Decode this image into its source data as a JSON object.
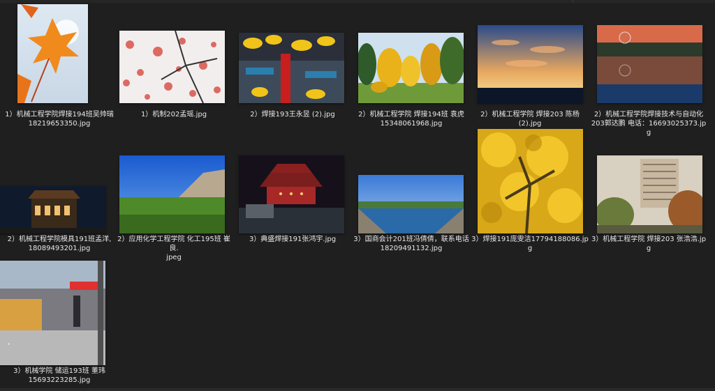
{
  "files": [
    {
      "line1": "1）机械工程学院焊接194班吴帅瑞",
      "line2": "18219653350.jpg",
      "art": "maple-leaf"
    },
    {
      "line1": "1）机制202孟瑶.jpg",
      "line2": "",
      "art": "red-leaves"
    },
    {
      "line1": "2）焊接193王永昱 (2).jpg",
      "line2": "",
      "art": "temple-gold"
    },
    {
      "line1": "2）机械工程学院 焊接194班 袁虎",
      "line2": "15348061968.jpg",
      "art": "autumn-trees"
    },
    {
      "line1": "2）机械工程学院 焊接203 陈杨",
      "line2": "(2).jpg",
      "art": "sunset-lake"
    },
    {
      "line1": "2）机械工程学院焊接技术与自动化",
      "line2": "203郭达鹏  电话：16693025373.jpg",
      "art": "sunset-reflect"
    },
    {
      "line1": "2）机械工程学院模具191班孟洋,",
      "line2": "18089493201.jpg",
      "art": "night-tower"
    },
    {
      "line1": "2）应用化学工程学院 化工195班 崔良.",
      "line2": "jpeg",
      "art": "grass-mountain"
    },
    {
      "line1": "3）典盛焊接191张鸿宇.jpg",
      "line2": "",
      "art": "night-pavilion"
    },
    {
      "line1": "3）国商会计201班冯倩倩，联系电话",
      "line2": "18209491132.jpg",
      "art": "canal"
    },
    {
      "line1": "3）焊接191庞雯洁17794188086.jpg",
      "line2": "",
      "art": "ginkgo"
    },
    {
      "line1": "3）机械工程学院 焊接203 张浩浩.jpg",
      "line2": "",
      "art": "building"
    },
    {
      "line1": "3）机械学院 储运193班 董玮",
      "line2": "15693223285.jpg",
      "art": "street"
    }
  ]
}
